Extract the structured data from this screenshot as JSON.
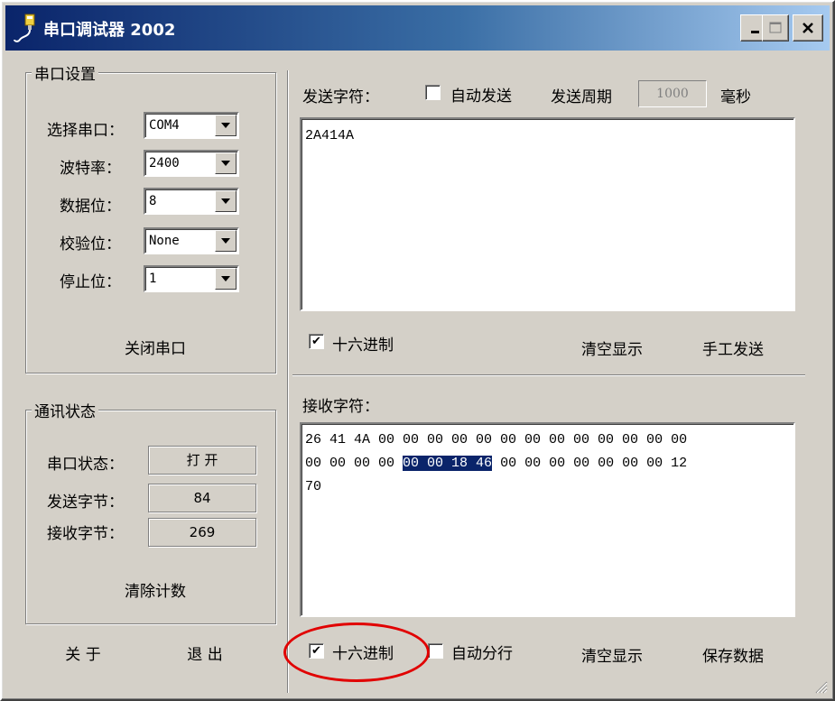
{
  "window": {
    "title": "串口调试器 2002"
  },
  "serial_settings": {
    "group_title": "串口设置",
    "fields": [
      {
        "label": "选择串口：",
        "value": "COM4"
      },
      {
        "label": "波特率：",
        "value": "2400"
      },
      {
        "label": "数据位：",
        "value": "8"
      },
      {
        "label": "校验位：",
        "value": "None"
      },
      {
        "label": "停止位：",
        "value": "1"
      }
    ],
    "close_button": "关闭串口"
  },
  "comm_status": {
    "group_title": "通讯状态",
    "rows": [
      {
        "label": "串口状态：",
        "value": "打 开"
      },
      {
        "label": "发送字节：",
        "value": "84"
      },
      {
        "label": "接收字节：",
        "value": "269"
      }
    ],
    "clear_button": "清除计数"
  },
  "bottom_left": {
    "about": "关 于",
    "exit": "退 出"
  },
  "send": {
    "label": "发送字符：",
    "auto_send_label": "自动发送",
    "auto_send_checked": false,
    "period_label": "发送周期",
    "period_value": "1000",
    "period_unit": "毫秒",
    "text": "2A414A",
    "hex_label": "十六进制",
    "hex_checked": true,
    "clear_button": "清空显示",
    "manual_send_button": "手工发送"
  },
  "receive": {
    "label": "接收字符：",
    "line1": "26 41 4A 00 00 00 00 00 00 00 00 00 00 00 00 00",
    "line2_before": "00 00 00 00 ",
    "line2_selected": "00 00 18 46",
    "line2_after": " 00 00 00 00 00 00 00 12",
    "line3": "70",
    "hex_label": "十六进制",
    "hex_checked": true,
    "auto_wrap_label": "自动分行",
    "auto_wrap_checked": false,
    "clear_button": "清空显示",
    "save_button": "保存数据"
  },
  "checkmark_glyph": "✔",
  "colors": {
    "title_bar": "#0a246a",
    "selection": "#0a246a",
    "annotation": "#e10000",
    "face": "#d4d0c8"
  }
}
